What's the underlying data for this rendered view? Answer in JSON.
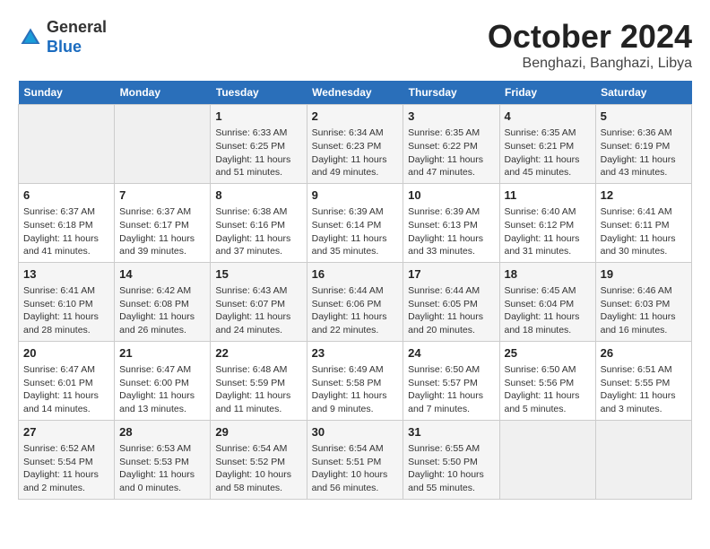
{
  "header": {
    "logo_general": "General",
    "logo_blue": "Blue",
    "title": "October 2024",
    "location": "Benghazi, Banghazi, Libya"
  },
  "calendar": {
    "days_of_week": [
      "Sunday",
      "Monday",
      "Tuesday",
      "Wednesday",
      "Thursday",
      "Friday",
      "Saturday"
    ],
    "weeks": [
      [
        {
          "day": "",
          "info": ""
        },
        {
          "day": "",
          "info": ""
        },
        {
          "day": "1",
          "info": "Sunrise: 6:33 AM\nSunset: 6:25 PM\nDaylight: 11 hours and 51 minutes."
        },
        {
          "day": "2",
          "info": "Sunrise: 6:34 AM\nSunset: 6:23 PM\nDaylight: 11 hours and 49 minutes."
        },
        {
          "day": "3",
          "info": "Sunrise: 6:35 AM\nSunset: 6:22 PM\nDaylight: 11 hours and 47 minutes."
        },
        {
          "day": "4",
          "info": "Sunrise: 6:35 AM\nSunset: 6:21 PM\nDaylight: 11 hours and 45 minutes."
        },
        {
          "day": "5",
          "info": "Sunrise: 6:36 AM\nSunset: 6:19 PM\nDaylight: 11 hours and 43 minutes."
        }
      ],
      [
        {
          "day": "6",
          "info": "Sunrise: 6:37 AM\nSunset: 6:18 PM\nDaylight: 11 hours and 41 minutes."
        },
        {
          "day": "7",
          "info": "Sunrise: 6:37 AM\nSunset: 6:17 PM\nDaylight: 11 hours and 39 minutes."
        },
        {
          "day": "8",
          "info": "Sunrise: 6:38 AM\nSunset: 6:16 PM\nDaylight: 11 hours and 37 minutes."
        },
        {
          "day": "9",
          "info": "Sunrise: 6:39 AM\nSunset: 6:14 PM\nDaylight: 11 hours and 35 minutes."
        },
        {
          "day": "10",
          "info": "Sunrise: 6:39 AM\nSunset: 6:13 PM\nDaylight: 11 hours and 33 minutes."
        },
        {
          "day": "11",
          "info": "Sunrise: 6:40 AM\nSunset: 6:12 PM\nDaylight: 11 hours and 31 minutes."
        },
        {
          "day": "12",
          "info": "Sunrise: 6:41 AM\nSunset: 6:11 PM\nDaylight: 11 hours and 30 minutes."
        }
      ],
      [
        {
          "day": "13",
          "info": "Sunrise: 6:41 AM\nSunset: 6:10 PM\nDaylight: 11 hours and 28 minutes."
        },
        {
          "day": "14",
          "info": "Sunrise: 6:42 AM\nSunset: 6:08 PM\nDaylight: 11 hours and 26 minutes."
        },
        {
          "day": "15",
          "info": "Sunrise: 6:43 AM\nSunset: 6:07 PM\nDaylight: 11 hours and 24 minutes."
        },
        {
          "day": "16",
          "info": "Sunrise: 6:44 AM\nSunset: 6:06 PM\nDaylight: 11 hours and 22 minutes."
        },
        {
          "day": "17",
          "info": "Sunrise: 6:44 AM\nSunset: 6:05 PM\nDaylight: 11 hours and 20 minutes."
        },
        {
          "day": "18",
          "info": "Sunrise: 6:45 AM\nSunset: 6:04 PM\nDaylight: 11 hours and 18 minutes."
        },
        {
          "day": "19",
          "info": "Sunrise: 6:46 AM\nSunset: 6:03 PM\nDaylight: 11 hours and 16 minutes."
        }
      ],
      [
        {
          "day": "20",
          "info": "Sunrise: 6:47 AM\nSunset: 6:01 PM\nDaylight: 11 hours and 14 minutes."
        },
        {
          "day": "21",
          "info": "Sunrise: 6:47 AM\nSunset: 6:00 PM\nDaylight: 11 hours and 13 minutes."
        },
        {
          "day": "22",
          "info": "Sunrise: 6:48 AM\nSunset: 5:59 PM\nDaylight: 11 hours and 11 minutes."
        },
        {
          "day": "23",
          "info": "Sunrise: 6:49 AM\nSunset: 5:58 PM\nDaylight: 11 hours and 9 minutes."
        },
        {
          "day": "24",
          "info": "Sunrise: 6:50 AM\nSunset: 5:57 PM\nDaylight: 11 hours and 7 minutes."
        },
        {
          "day": "25",
          "info": "Sunrise: 6:50 AM\nSunset: 5:56 PM\nDaylight: 11 hours and 5 minutes."
        },
        {
          "day": "26",
          "info": "Sunrise: 6:51 AM\nSunset: 5:55 PM\nDaylight: 11 hours and 3 minutes."
        }
      ],
      [
        {
          "day": "27",
          "info": "Sunrise: 6:52 AM\nSunset: 5:54 PM\nDaylight: 11 hours and 2 minutes."
        },
        {
          "day": "28",
          "info": "Sunrise: 6:53 AM\nSunset: 5:53 PM\nDaylight: 11 hours and 0 minutes."
        },
        {
          "day": "29",
          "info": "Sunrise: 6:54 AM\nSunset: 5:52 PM\nDaylight: 10 hours and 58 minutes."
        },
        {
          "day": "30",
          "info": "Sunrise: 6:54 AM\nSunset: 5:51 PM\nDaylight: 10 hours and 56 minutes."
        },
        {
          "day": "31",
          "info": "Sunrise: 6:55 AM\nSunset: 5:50 PM\nDaylight: 10 hours and 55 minutes."
        },
        {
          "day": "",
          "info": ""
        },
        {
          "day": "",
          "info": ""
        }
      ]
    ]
  }
}
